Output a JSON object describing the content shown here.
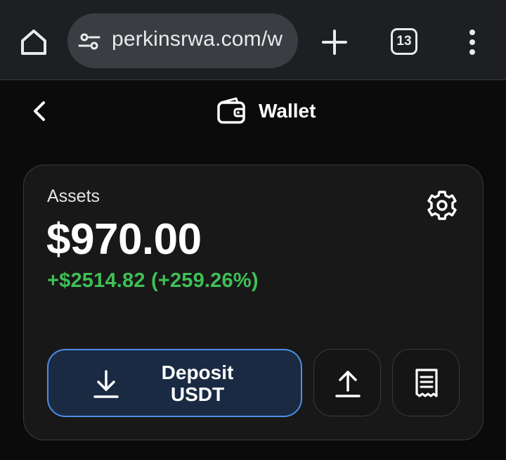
{
  "browser": {
    "url": "perkinsrwa.com/w",
    "tab_count": "13",
    "icons": {
      "home": "home-icon",
      "site_settings": "tune-icon",
      "new_tab": "plus-icon",
      "menu": "more-vertical-icon"
    }
  },
  "header": {
    "title": "Wallet",
    "icons": {
      "back": "chevron-left-icon",
      "wallet": "wallet-icon"
    }
  },
  "card": {
    "label": "Assets",
    "balance": "$970.00",
    "change": "+$2514.82 (+259.26%)",
    "deposit_line1": "Deposit",
    "deposit_line2": "USDT",
    "icons": {
      "settings": "gear-icon",
      "deposit": "download-icon",
      "withdraw": "upload-icon",
      "history": "receipt-icon"
    }
  },
  "colors": {
    "background": "#0b0b0b",
    "browser_bar": "#1d1f22",
    "card_bg": "#181818",
    "positive": "#3fbf55",
    "accent_border": "#4d8fe6",
    "accent_bg": "#1a2a43"
  }
}
